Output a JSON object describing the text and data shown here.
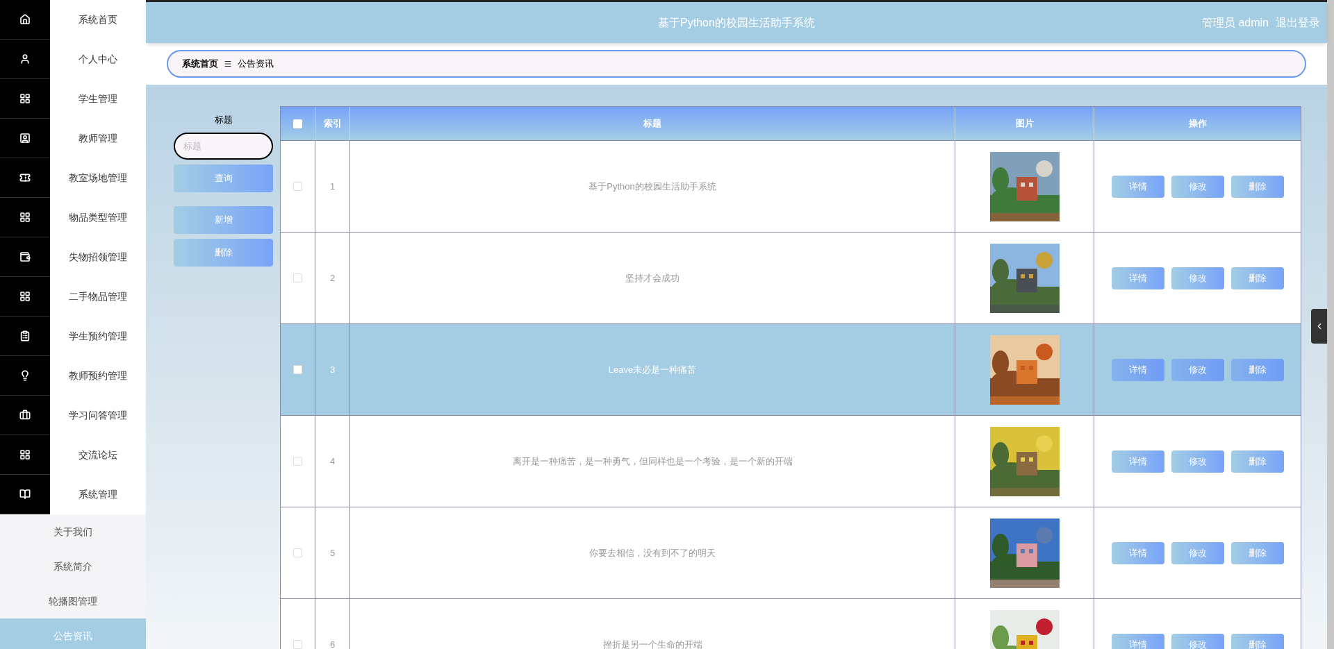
{
  "sidebar": {
    "items": [
      {
        "label": "系统首页"
      },
      {
        "label": "个人中心"
      },
      {
        "label": "学生管理"
      },
      {
        "label": "教师管理"
      },
      {
        "label": "教室场地管理"
      },
      {
        "label": "物品类型管理"
      },
      {
        "label": "失物招领管理"
      },
      {
        "label": "二手物品管理"
      },
      {
        "label": "学生预约管理"
      },
      {
        "label": "教师预约管理"
      },
      {
        "label": "学习问答管理"
      },
      {
        "label": "交流论坛"
      },
      {
        "label": "系统管理"
      }
    ],
    "sub_items": [
      {
        "label": "关于我们",
        "selected": false
      },
      {
        "label": "系统简介",
        "selected": false
      },
      {
        "label": "轮播图管理",
        "selected": false
      },
      {
        "label": "公告资讯",
        "selected": true
      }
    ]
  },
  "header": {
    "title": "基于Python的校园生活助手系统",
    "user": "管理员 admin",
    "logout": "退出登录"
  },
  "breadcrumb": {
    "home": "系统首页",
    "current": "公告资讯"
  },
  "search": {
    "label": "标题",
    "placeholder": "标题",
    "query_button": "查询",
    "add_button": "新增",
    "delete_button": "删除"
  },
  "table": {
    "select_all": {
      "checked": false
    },
    "columns": [
      "索引",
      "标题",
      "图片",
      "操作"
    ],
    "rows": [
      {
        "checked": false,
        "hovered": false,
        "index": "1",
        "title": "基于Python的校园生活助手系统",
        "image": {
          "kind": "picture"
        },
        "actions": [
          "详情",
          "修改",
          "删除"
        ]
      },
      {
        "checked": false,
        "hovered": false,
        "index": "2",
        "title": "坚持才会成功",
        "image": {
          "kind": "picture"
        },
        "actions": [
          "详情",
          "修改",
          "删除"
        ]
      },
      {
        "checked": false,
        "hovered": true,
        "index": "3",
        "title": "Leave未必是一种痛苦",
        "image": {
          "kind": "picture"
        },
        "actions": [
          "详情",
          "修改",
          "删除"
        ]
      },
      {
        "checked": false,
        "hovered": false,
        "index": "4",
        "title": "离开是一种痛苦，是一种勇气，但同样也是一个考验，是一个新的开端",
        "image": {
          "kind": "picture"
        },
        "actions": [
          "详情",
          "修改",
          "删除"
        ]
      },
      {
        "checked": false,
        "hovered": false,
        "index": "5",
        "title": "你要去相信，没有到不了的明天",
        "image": {
          "kind": "picture"
        },
        "actions": [
          "详情",
          "修改",
          "删除"
        ]
      },
      {
        "checked": false,
        "hovered": false,
        "index": "6",
        "title": "挫折是另一个生命的开端",
        "image": {
          "kind": "picture"
        },
        "actions": [
          "详情",
          "修改",
          "删除"
        ]
      }
    ]
  }
}
